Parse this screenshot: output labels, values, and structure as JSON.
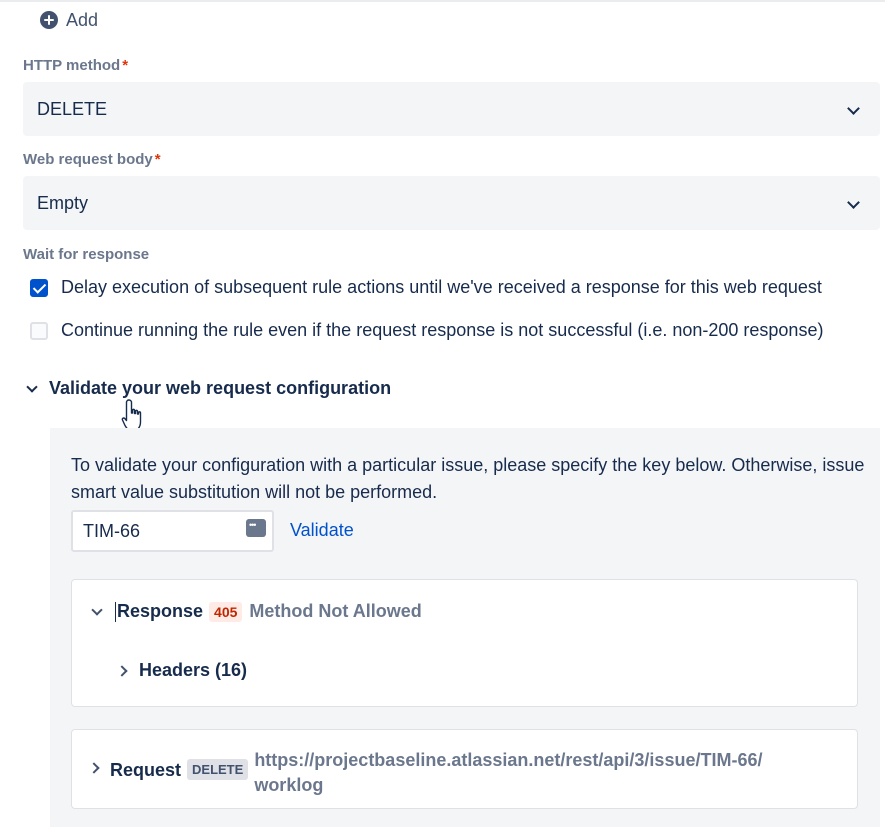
{
  "add": {
    "label": "Add",
    "icon": "plus-circle-icon"
  },
  "http_method": {
    "label": "HTTP method",
    "required_mark": "*",
    "value": "DELETE"
  },
  "body": {
    "label": "Web request body",
    "required_mark": "*",
    "value": "Empty"
  },
  "wait": {
    "label": "Wait for response",
    "options": [
      {
        "label": "Delay execution of subsequent rule actions until we've received a response for this web request",
        "checked": true
      },
      {
        "label": "Continue running the rule even if the request response is not successful (i.e. non-200 response)",
        "checked": false
      }
    ]
  },
  "validate": {
    "title": "Validate your web request configuration",
    "instructions": "To validate your configuration with a particular issue, please specify the key below. Otherwise, issue smart value substitution will not be performed.",
    "issue_key": "TIM-66",
    "validate_label": "Validate",
    "response": {
      "label": "Response",
      "status_code": "405",
      "status_text": "Method Not Allowed",
      "headers_label": "Headers (16)"
    },
    "request": {
      "label": "Request",
      "method_badge": "DELETE",
      "url": "https://projectbaseline.atlassian.net/rest/api/3/issue/TIM-66/worklog"
    }
  },
  "colors": {
    "accent": "#0052cc",
    "error_badge_bg": "#ffebe6",
    "error_badge_text": "#bf2600",
    "panel_bg": "#f4f5f7"
  }
}
